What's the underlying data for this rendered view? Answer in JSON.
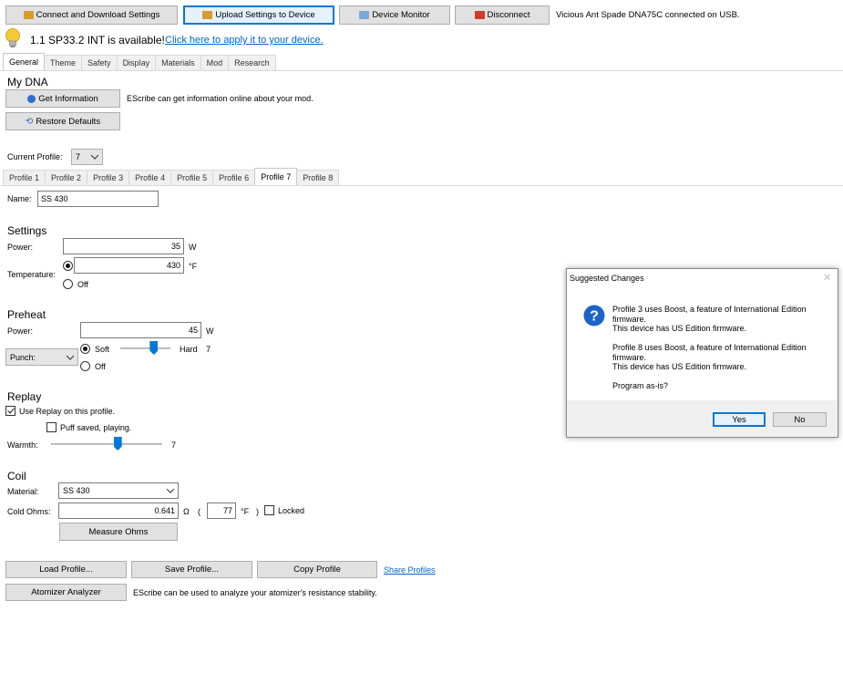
{
  "toolbar": {
    "connect_label": "Connect and Download Settings",
    "upload_label": "Upload Settings to Device",
    "monitor_label": "Device Monitor",
    "disconnect_label": "Disconnect",
    "status": "Vicious Ant Spade DNA75C connected on USB."
  },
  "update_bar": {
    "message": "1.1 SP33.2 INT is available!",
    "link": "Click here to apply it to your device."
  },
  "main_tabs": [
    "General",
    "Theme",
    "Safety",
    "Display",
    "Materials",
    "Mod",
    "Research"
  ],
  "my_dna": {
    "heading": "My DNA",
    "get_info_label": "Get Information",
    "get_info_desc": "EScribe can get information online about your mod.",
    "restore_label": "Restore Defaults"
  },
  "profile": {
    "current_label": "Current Profile:",
    "current_value": "7",
    "tabs": [
      "Profile 1",
      "Profile 2",
      "Profile 3",
      "Profile 4",
      "Profile 5",
      "Profile 6",
      "Profile 7",
      "Profile 8"
    ],
    "name_label": "Name:",
    "name_value": "SS 430"
  },
  "settings": {
    "heading": "Settings",
    "power_label": "Power:",
    "power_value": "35",
    "power_unit": "W",
    "temp_label": "Temperature:",
    "temp_value": "430",
    "temp_unit": "°F",
    "off_label": "Off"
  },
  "preheat": {
    "heading": "Preheat",
    "power_label": "Power:",
    "power_value": "45",
    "power_unit": "W",
    "punch_value": "Punch:",
    "soft_label": "Soft",
    "hard_label": "Hard",
    "punch_level": "7",
    "punch_slider_fraction": 0.67,
    "off_label": "Off"
  },
  "replay": {
    "heading": "Replay",
    "use_replay_label": "Use Replay on this profile.",
    "puff_saved_label": "Puff saved, playing.",
    "warmth_label": "Warmth:",
    "warmth_value": "7",
    "warmth_slider_fraction": 0.6
  },
  "coil": {
    "heading": "Coil",
    "material_label": "Material:",
    "material_value": "SS 430",
    "cold_ohms_label": "Cold Ohms:",
    "cold_ohms_value": "0.641",
    "ohm_symbol": "Ω",
    "paren_open": "(",
    "temp_value": "77",
    "temp_unit": "°F",
    "paren_close": ")",
    "locked_label": "Locked",
    "measure_label": "Measure Ohms"
  },
  "bottom": {
    "load_label": "Load Profile...",
    "save_label": "Save Profile...",
    "copy_label": "Copy Profile",
    "share_link": "Share Profiles",
    "analyzer_label": "Atomizer Analyzer",
    "analyzer_desc": "EScribe can be used to analyze your atomizer's resistance stability."
  },
  "dialog": {
    "title": "Suggested Changes",
    "line1": "Profile 3 uses Boost, a feature of International Edition",
    "line2": "firmware.",
    "line3": "This device has US Edition firmware.",
    "line4": "Profile 8 uses Boost, a feature of International Edition",
    "line5": "firmware.",
    "line6": "This device has US Edition firmware.",
    "question": "Program as-is?",
    "yes_label": "Yes",
    "no_label": "No"
  },
  "colors": {
    "accent": "#0078d7",
    "link": "#0066cc"
  }
}
